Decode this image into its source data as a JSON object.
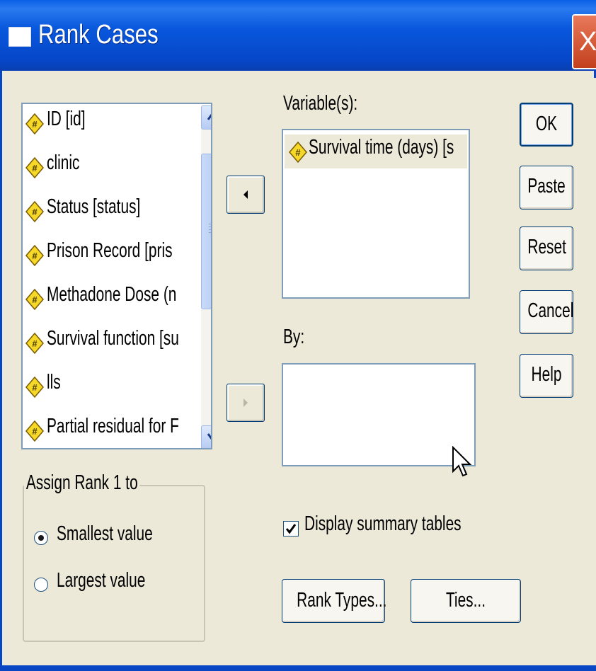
{
  "window": {
    "title": "Rank Cases",
    "close_label": "X"
  },
  "source_list": {
    "items": [
      {
        "label": "ID [id]",
        "icon": "numeric-variable-icon"
      },
      {
        "label": "clinic",
        "icon": "numeric-variable-icon"
      },
      {
        "label": "Status [status]",
        "icon": "numeric-variable-icon"
      },
      {
        "label": "Prison Record [pris",
        "icon": "numeric-variable-icon"
      },
      {
        "label": "Methadone Dose (n",
        "icon": "numeric-variable-icon"
      },
      {
        "label": "Survival function [su",
        "icon": "numeric-variable-icon"
      },
      {
        "label": "lls",
        "icon": "numeric-variable-icon"
      },
      {
        "label": "Partial residual for F",
        "icon": "numeric-variable-icon"
      }
    ]
  },
  "variables": {
    "label": "Variable(s):",
    "items": [
      {
        "label": "Survival time (days) [s",
        "icon": "numeric-variable-icon"
      }
    ]
  },
  "by": {
    "label": "By:"
  },
  "buttons": {
    "ok": "OK",
    "paste": "Paste",
    "reset": "Reset",
    "cancel": "Cancel",
    "help": "Help",
    "rank_types": "Rank Types...",
    "ties": "Ties..."
  },
  "assign_rank": {
    "legend": "Assign Rank 1 to",
    "options": [
      {
        "label": "Smallest value",
        "checked": true
      },
      {
        "label": "Largest value",
        "checked": false
      }
    ]
  },
  "display_summary": {
    "label": "Display summary tables",
    "checked": true
  }
}
